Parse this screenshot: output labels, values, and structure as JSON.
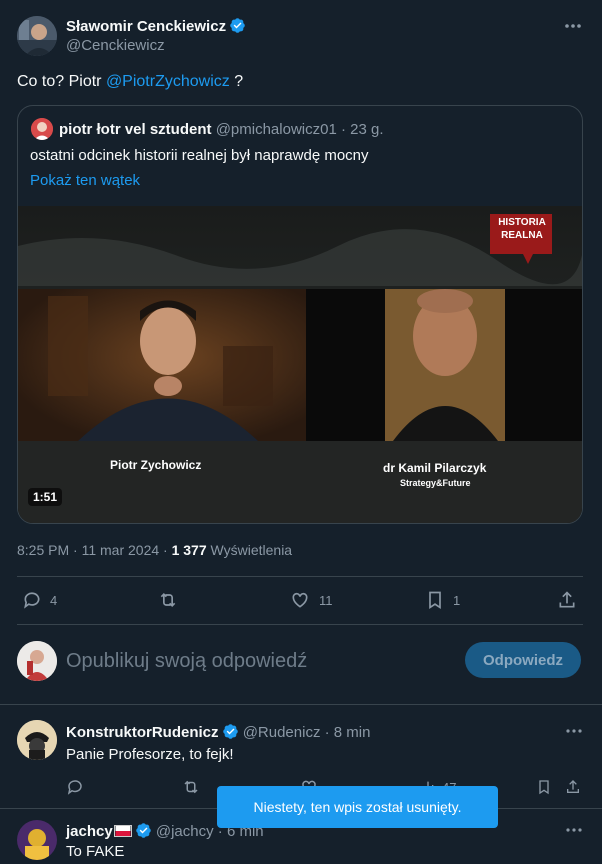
{
  "tweet": {
    "author_name": "Sławomir Cenckiewicz",
    "author_handle": "@Cenckiewicz",
    "text_prefix": "Co to? Piotr ",
    "mention": "@PiotrZychowicz",
    "text_suffix": " ?",
    "timestamp": "8:25 PM · 11 mar 2024 · ",
    "views_count": "1 377",
    "views_label": " Wyświetlenia",
    "replies": "4",
    "retweets": "",
    "likes": "11",
    "bookmarks": "1"
  },
  "quote": {
    "author_name": "piotr łotr vel sztudent",
    "author_handle": "@pmichalowicz01",
    "age": " · 23 g.",
    "text": "ostatni odcinek historii realnej był naprawdę mocny",
    "thread_link": "Pokaż ten wątek",
    "video": {
      "duration": "1:51",
      "logo_line1": "HISTORIA",
      "logo_line2": "REALNA",
      "guest1": "Piotr Zychowicz",
      "guest2": "dr Kamil Pilarczyk",
      "guest2_org": "Strategy&Future"
    }
  },
  "composer": {
    "placeholder": "Opublikuj swoją odpowiedź",
    "button": "Odpowiedz"
  },
  "replies": [
    {
      "author_name": "KonstruktorRudenicz",
      "author_handle": "@Rudenicz",
      "age": " · 8 min",
      "text": "Panie Profesorze, to fejk!",
      "views": "47"
    },
    {
      "author_name": "jachcy",
      "author_handle": "@jachcy",
      "age": " · 6 min",
      "text": "To FAKE"
    }
  ],
  "toast": "Niestety, ten wpis został usunięty.",
  "colors": {
    "background": "#15202b",
    "accent": "#1d9bf0",
    "border": "#38444d",
    "muted": "#8b98a5"
  }
}
